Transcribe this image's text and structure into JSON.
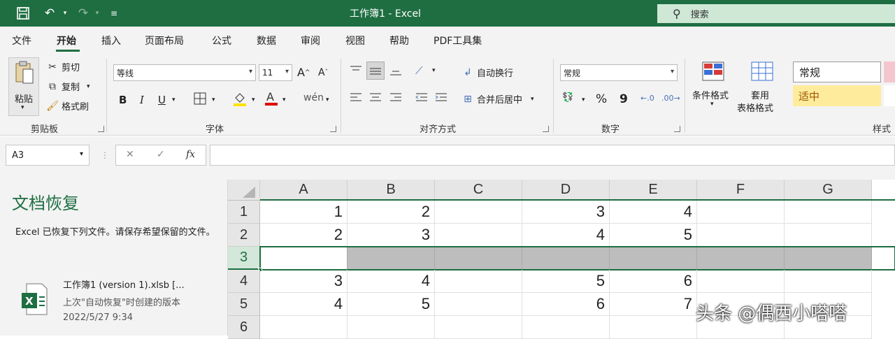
{
  "window": {
    "title": "工作簿1 - Excel",
    "search_placeholder": "搜索"
  },
  "menu": {
    "items": [
      {
        "label": "文件",
        "active": false
      },
      {
        "label": "开始",
        "active": true
      },
      {
        "label": "插入",
        "active": false
      },
      {
        "label": "页面布局",
        "active": false
      },
      {
        "label": "公式",
        "active": false
      },
      {
        "label": "数据",
        "active": false
      },
      {
        "label": "审阅",
        "active": false
      },
      {
        "label": "视图",
        "active": false
      },
      {
        "label": "帮助",
        "active": false
      },
      {
        "label": "PDF工具集",
        "active": false
      }
    ]
  },
  "ribbon": {
    "clipboard": {
      "paste": "粘贴",
      "cut": "剪切",
      "copy": "复制",
      "format_painter": "格式刷",
      "group": "剪贴板"
    },
    "font": {
      "name": "等线",
      "size": "11",
      "group": "字体",
      "bold": "B",
      "italic": "I",
      "underline": "U"
    },
    "alignment": {
      "wrap": "自动换行",
      "merge": "合并后居中",
      "group": "对齐方式"
    },
    "number": {
      "format": "常规",
      "percent": "%",
      "comma": "9",
      "group": "数字"
    },
    "styles": {
      "conditional": "条件格式",
      "table_line1": "套用",
      "table_line2": "表格格式",
      "normal": "常规",
      "neutral": "适中",
      "group": "样式"
    }
  },
  "formula_bar": {
    "name_box": "A3",
    "cancel": "✕",
    "enter": "✓",
    "fx": "fx",
    "formula": ""
  },
  "recovery": {
    "title": "文档恢复",
    "description": "Excel 已恢复下列文件。请保存希望保留的文件。",
    "file_name": "工作簿1 (version 1).xlsb  [...",
    "file_note": "上次\"自动恢复\"时创建的版本",
    "file_date": "2022/5/27 9:34"
  },
  "sheet": {
    "columns": [
      "A",
      "B",
      "C",
      "D",
      "E",
      "F",
      "G"
    ],
    "rows": [
      {
        "num": "1",
        "cells": [
          "1",
          "2",
          "",
          "3",
          "4",
          "",
          ""
        ]
      },
      {
        "num": "2",
        "cells": [
          "2",
          "3",
          "",
          "4",
          "5",
          "",
          ""
        ]
      },
      {
        "num": "3",
        "cells": [
          "",
          "",
          "",
          "",
          "",
          "",
          ""
        ]
      },
      {
        "num": "4",
        "cells": [
          "3",
          "4",
          "",
          "5",
          "6",
          "",
          ""
        ]
      },
      {
        "num": "5",
        "cells": [
          "4",
          "5",
          "",
          "6",
          "7",
          "",
          ""
        ]
      },
      {
        "num": "6",
        "cells": [
          "",
          "",
          "",
          "",
          "",
          "",
          ""
        ]
      }
    ],
    "selected_row": "3"
  },
  "watermark": "头条 @偶西小嗒嗒",
  "colors": {
    "accent": "#1e6e42",
    "search_bg": "#cfe8d6",
    "neutral_style": "#ffeb9c",
    "selection_fill": "#bdbdbd"
  }
}
